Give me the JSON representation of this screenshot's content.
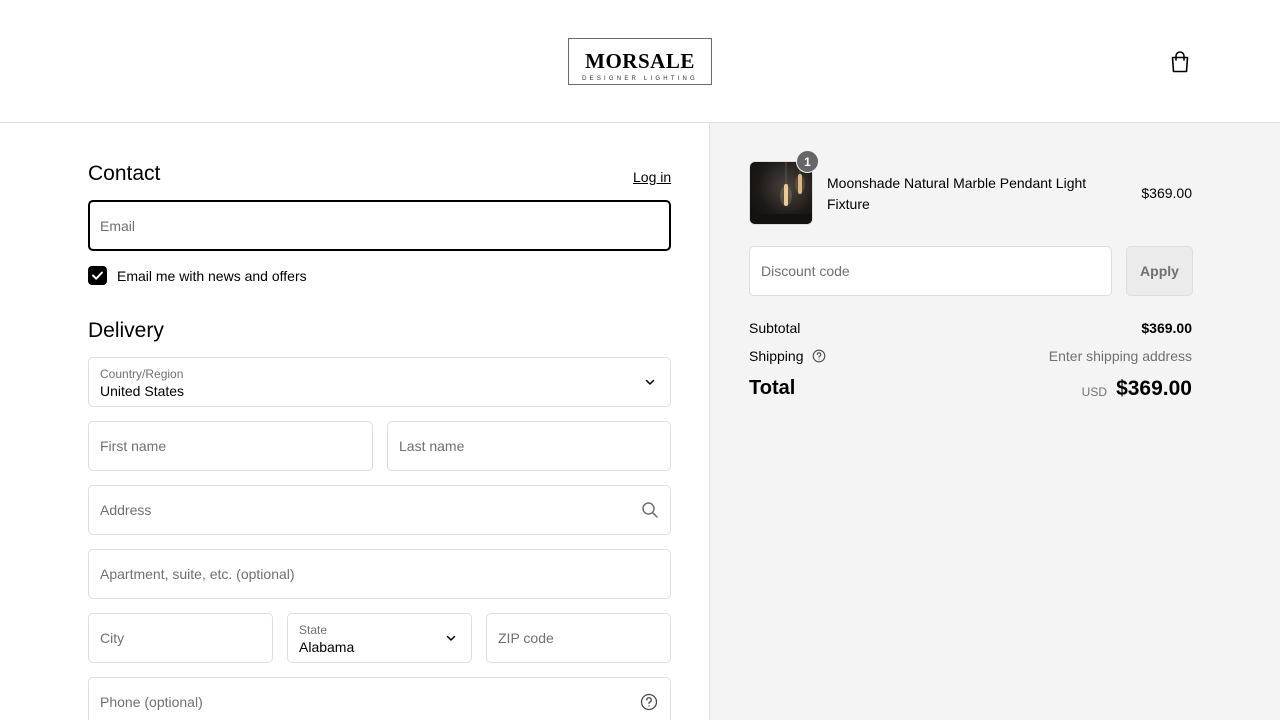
{
  "header": {
    "logo_name": "MORSALE",
    "logo_tagline": "DESIGNER LIGHTING",
    "cart_icon": "shopping-bag-icon"
  },
  "contact": {
    "heading": "Contact",
    "login_link": "Log in",
    "email_placeholder": "Email",
    "newsletter_label": "Email me with news and offers",
    "newsletter_checked": true
  },
  "delivery": {
    "heading": "Delivery",
    "country_label": "Country/Region",
    "country_value": "United States",
    "first_name_placeholder": "First name",
    "last_name_placeholder": "Last name",
    "address_placeholder": "Address",
    "apartment_placeholder": "Apartment, suite, etc. (optional)",
    "city_placeholder": "City",
    "state_label": "State",
    "state_value": "Alabama",
    "zip_placeholder": "ZIP code",
    "phone_placeholder": "Phone (optional)"
  },
  "order": {
    "item": {
      "name": "Moonshade Natural Marble Pendant Light Fixture",
      "quantity": "1",
      "price": "$369.00"
    },
    "discount_placeholder": "Discount code",
    "apply_label": "Apply",
    "subtotal_label": "Subtotal",
    "subtotal_value": "$369.00",
    "shipping_label": "Shipping",
    "shipping_value": "Enter shipping address",
    "total_label": "Total",
    "total_currency": "USD",
    "total_value": "$369.00"
  },
  "colors": {
    "accent": "#000000",
    "border": "#dedede",
    "muted_text": "#707070",
    "summary_bg": "#f4f4f4"
  }
}
